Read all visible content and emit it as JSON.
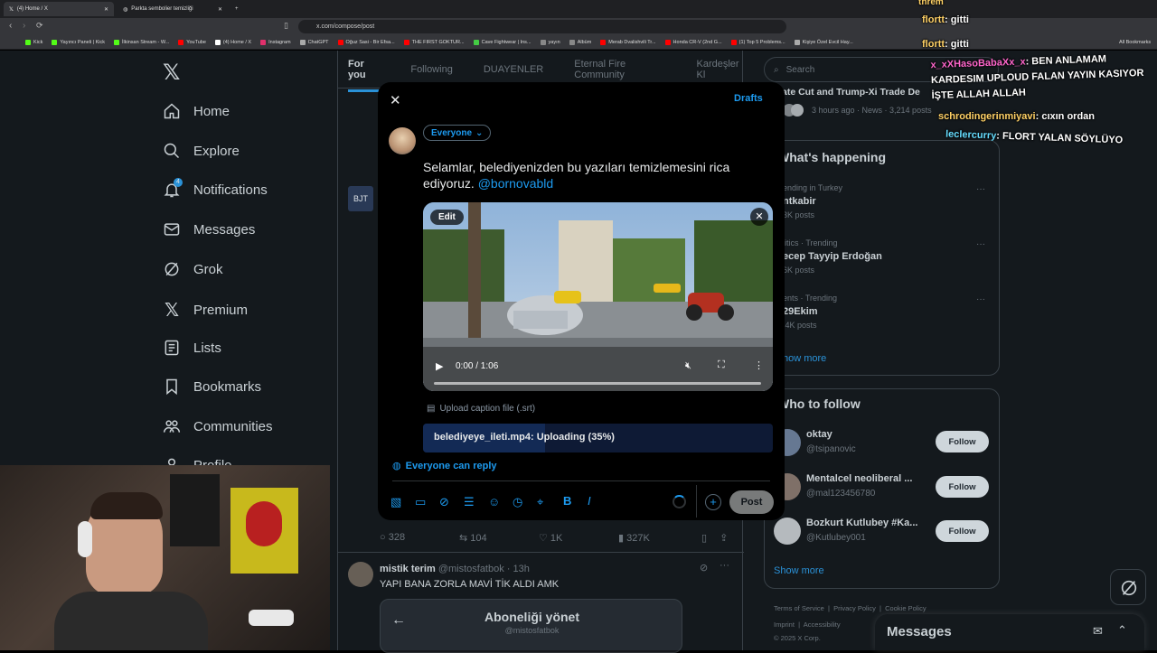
{
  "browser": {
    "tabs": [
      {
        "label": "(4) Home / X"
      },
      {
        "label": "Parkta sembolier temizliği"
      }
    ],
    "url": "x.com/compose/post",
    "bookmarks": [
      "Kick",
      "Yayıncı Paneli | Kick",
      "İlkinsan Stream - W...",
      "YouTube",
      "(4) Home / X",
      "Instagram",
      "ChatGPT",
      "Oğuz Sasi - Bir Efsa...",
      "THE FIRST GOKTUR...",
      "Cave Fightwear | Ins...",
      "yayın",
      "Albüm",
      "Merab Dvalishvili Tr...",
      "Honda CR-V (2nd G...",
      "(1) Top 5 Problems...",
      "Kişiye Özel Evcil Hay..."
    ],
    "all_bookmarks": "All Bookmarks"
  },
  "nav": {
    "items": [
      {
        "label": "Home",
        "icon": "home-icon"
      },
      {
        "label": "Explore",
        "icon": "search-icon"
      },
      {
        "label": "Notifications",
        "icon": "bell-icon",
        "badge": "4"
      },
      {
        "label": "Messages",
        "icon": "mail-icon"
      },
      {
        "label": "Grok",
        "icon": "grok-icon"
      },
      {
        "label": "Premium",
        "icon": "x-icon"
      },
      {
        "label": "Lists",
        "icon": "list-icon"
      },
      {
        "label": "Bookmarks",
        "icon": "bookmark-icon"
      },
      {
        "label": "Communities",
        "icon": "people-icon"
      },
      {
        "label": "Profile",
        "icon": "user-icon"
      }
    ]
  },
  "feed": {
    "tabs": [
      "For you",
      "Following",
      "DUAYENLER",
      "Eternal Fire Community",
      "Kardeşler Kl"
    ],
    "post_actions": {
      "replies": "328",
      "reposts": "104",
      "likes": "1K",
      "views": "327K"
    },
    "post2": {
      "name": "mistik terim",
      "handle": "@mistosfatbok",
      "time": "· 13h",
      "text": "YAPI BANA ZORLA MAVİ TİK ALDI AMK"
    },
    "subscription_card": {
      "title": "Aboneliği yönet",
      "handle": "@mistosfatbok"
    }
  },
  "right": {
    "search_placeholder": "Search",
    "top_news": {
      "title": "ate Cut and Trump-Xi Trade De",
      "meta": "3 hours ago · News · 3,214 posts"
    },
    "happening_title": "What's happening",
    "trends": [
      {
        "context": "ending in Turkey",
        "title": "ntkabir",
        "posts": "3K posts"
      },
      {
        "context": "litics · Trending",
        "title": "ecep Tayyip Erdoğan",
        "posts": "6K posts"
      },
      {
        "context": "ents · Trending",
        "title": "29Ekim",
        "posts": ".4K posts"
      }
    ],
    "show_more": "how more",
    "who_to_follow_title": "Who to follow",
    "suggestions": [
      {
        "name": "oktay",
        "handle": "@tsipanovic",
        "button": "Follow"
      },
      {
        "name": "Mentalcel neoliberal ...",
        "handle": "@mal123456780",
        "button": "Follow"
      },
      {
        "name": "Bozkurt Kutlubey #Ka...",
        "handle": "@Kutlubey001",
        "button": "Follow"
      }
    ],
    "show_more_follow": "Show more",
    "footer": [
      "Terms of Service",
      "Privacy Policy",
      "Cookie Policy",
      "Imprint",
      "Accessibility",
      "© 2025 X Corp."
    ],
    "messages_drawer": "Messages"
  },
  "chat_overlay": [
    {
      "user": "threm",
      "text": ""
    },
    {
      "user": "flortt",
      "text": "gitti"
    },
    {
      "user": "flortt",
      "text": "gitti"
    },
    {
      "user": "x_xXHasoBabaXx_x",
      "text": "BEN ANLAMAM KARDESIM UPLOUD FALAN YAYIN KASIYOR İŞTE ALLAH ALLAH"
    },
    {
      "user": "schrodingerinmiyavi",
      "text": "cıxın ordan"
    },
    {
      "user": "leclercurry",
      "text": "FLORT YALAN SÖYLÜYO"
    }
  ],
  "composer": {
    "drafts": "Drafts",
    "audience": "Everyone",
    "text": "Selamlar, belediyenizden bu yazıları temizlemesini rica ediyoruz.",
    "mention": "@bornovabld",
    "video": {
      "edit": "Edit",
      "time": "0:00 / 1:06"
    },
    "caption_upload": "Upload caption file (.srt)",
    "upload_status": "belediyeye_ileti.mp4: Uploading (35%)",
    "upload_progress": 0.35,
    "reply_setting": "Everyone can reply",
    "post_button": "Post"
  }
}
